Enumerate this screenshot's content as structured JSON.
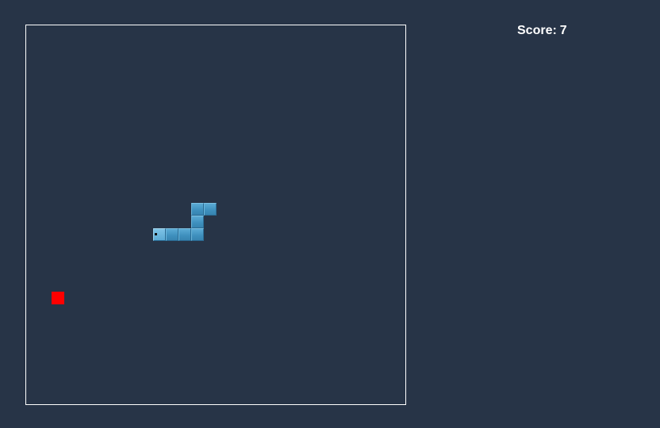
{
  "score": {
    "label": "Score:",
    "value": "7"
  },
  "game": {
    "grid_cols": 30,
    "grid_rows": 30,
    "snake": [
      [
        10,
        16
      ],
      [
        11,
        16
      ],
      [
        12,
        16
      ],
      [
        13,
        16
      ],
      [
        13,
        15
      ],
      [
        13,
        14
      ],
      [
        14,
        14
      ]
    ],
    "snake_head_direction": "left",
    "food": [
      2,
      21
    ],
    "colors": {
      "background": "#273447",
      "border": "#ffffff",
      "snake": "#4a9ccb",
      "food": "#ff0000",
      "text": "#ffffff"
    }
  }
}
